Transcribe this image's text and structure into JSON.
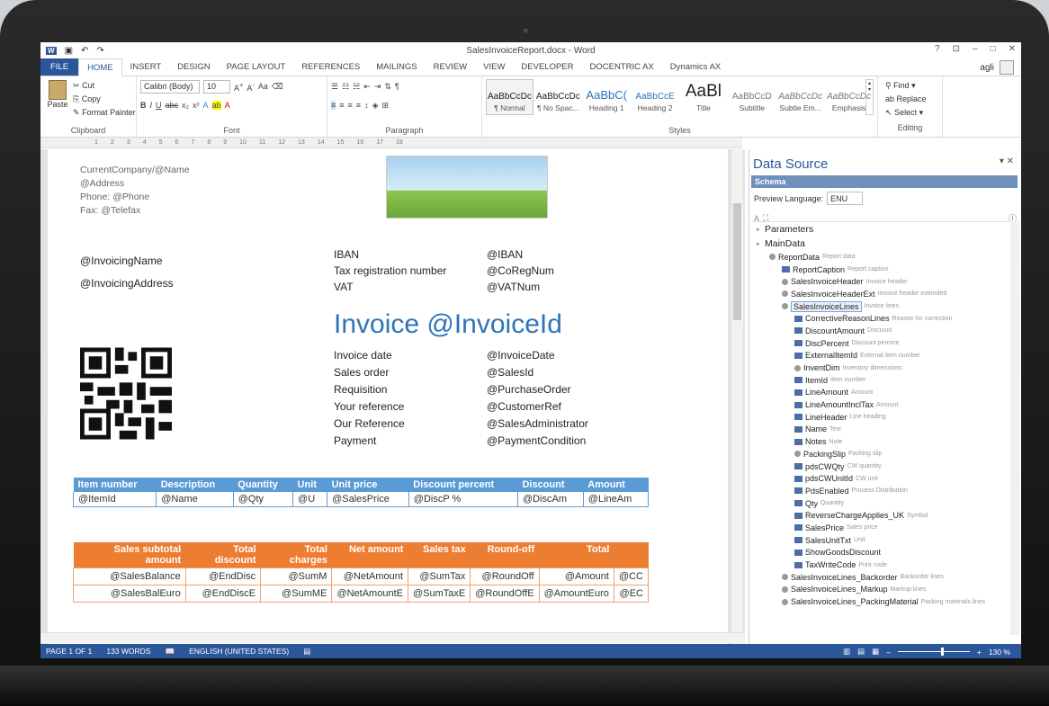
{
  "window": {
    "title": "SalesInvoiceReport.docx - Word",
    "help": "?",
    "user": "agli"
  },
  "tabs": [
    "FILE",
    "HOME",
    "INSERT",
    "DESIGN",
    "PAGE LAYOUT",
    "REFERENCES",
    "MAILINGS",
    "REVIEW",
    "VIEW",
    "DEVELOPER",
    "DOCENTRIC AX",
    "Dynamics AX"
  ],
  "ribbon": {
    "clipboard": {
      "paste": "Paste",
      "cut": "Cut",
      "copy": "Copy",
      "format_painter": "Format Painter",
      "label": "Clipboard"
    },
    "font": {
      "family": "Calibri (Body)",
      "size": "10",
      "label": "Font"
    },
    "paragraph": {
      "label": "Paragraph"
    },
    "styles": {
      "label": "Styles",
      "items": [
        {
          "preview": "AaBbCcDc",
          "name": "¶ Normal"
        },
        {
          "preview": "AaBbCcDc",
          "name": "¶ No Spac..."
        },
        {
          "preview": "AaBbC(",
          "name": "Heading 1"
        },
        {
          "preview": "AaBbCcE",
          "name": "Heading 2"
        },
        {
          "preview": "AaBl",
          "name": "Title"
        },
        {
          "preview": "AaBbCcD",
          "name": "Subtitle"
        },
        {
          "preview": "AaBbCcDc",
          "name": "Subtle Em..."
        },
        {
          "preview": "AaBbCcDc",
          "name": "Emphasis"
        }
      ]
    },
    "editing": {
      "find": "Find",
      "replace": "Replace",
      "select": "Select",
      "label": "Editing"
    }
  },
  "doc": {
    "company": "CurrentCompany/@Name",
    "address": "@Address",
    "phone": "Phone: @Phone",
    "fax": "Fax: @Telefax",
    "invoicing_name": "@InvoicingName",
    "invoicing_address": "@InvoicingAddress",
    "bank": [
      [
        "IBAN",
        "@IBAN"
      ],
      [
        "Tax registration number",
        "@CoRegNum"
      ],
      [
        "VAT",
        "@VATNum"
      ]
    ],
    "invoice_title": "Invoice @InvoiceId",
    "details": [
      [
        "Invoice date",
        "@InvoiceDate"
      ],
      [
        "Sales order",
        "@SalesId"
      ],
      [
        "Requisition",
        "@PurchaseOrder"
      ],
      [
        "Your reference",
        "@CustomerRef"
      ],
      [
        "Our Reference",
        "@SalesAdministrator"
      ],
      [
        "Payment",
        "@PaymentCondition"
      ]
    ],
    "lines_table": {
      "headers": [
        "Item number",
        "Description",
        "Quantity",
        "Unit",
        "Unit price",
        "Discount percent",
        "Discount",
        "Amount"
      ],
      "row": [
        "@ItemId",
        "@Name",
        "@Qty",
        "@U",
        "@SalesPrice",
        "@DiscP %",
        "@DiscAm",
        "@LineAm"
      ]
    },
    "totals_table": {
      "headers": [
        "Sales subtotal amount",
        "Total discount",
        "Total charges",
        "Net amount",
        "Sales tax",
        "Round-off",
        "Total",
        ""
      ],
      "rows": [
        [
          "@SalesBalance",
          "@EndDisc",
          "@SumM",
          "@NetAmount",
          "@SumTax",
          "@RoundOff",
          "@Amount",
          "@CC"
        ],
        [
          "@SalesBalEuro",
          "@EndDiscE",
          "@SumME",
          "@NetAmountE",
          "@SumTaxE",
          "@RoundOffE",
          "@AmountEuro",
          "@EC"
        ]
      ]
    }
  },
  "panel": {
    "title": "Data Source",
    "schema": "Schema",
    "preview_language_label": "Preview Language:",
    "preview_language": "ENU",
    "tree": [
      {
        "d": 0,
        "t": "arr",
        "n": "Parameters",
        "desc": ""
      },
      {
        "d": 0,
        "t": "arr",
        "n": "MainData",
        "desc": ""
      },
      {
        "d": 1,
        "t": "circ",
        "n": "ReportData",
        "desc": "Report data"
      },
      {
        "d": 2,
        "t": "bx",
        "n": "ReportCaption",
        "desc": "Report caption"
      },
      {
        "d": 2,
        "t": "circ",
        "n": "SalesInvoiceHeader",
        "desc": "Invoice header"
      },
      {
        "d": 2,
        "t": "circ",
        "n": "SalesInvoiceHeaderExt",
        "desc": "Invoice header extended"
      },
      {
        "d": 2,
        "t": "circ",
        "n": "SalesInvoiceLines",
        "desc": "Invoice lines",
        "sel": true
      },
      {
        "d": 3,
        "t": "bx",
        "n": "CorrectiveReasonLines",
        "desc": "Reason for correction"
      },
      {
        "d": 3,
        "t": "bx",
        "n": "DiscountAmount",
        "desc": "Discount"
      },
      {
        "d": 3,
        "t": "bx",
        "n": "DiscPercent",
        "desc": "Discount percent"
      },
      {
        "d": 3,
        "t": "bx",
        "n": "ExternalItemId",
        "desc": "External item number"
      },
      {
        "d": 3,
        "t": "circ",
        "n": "InventDim",
        "desc": "Inventory dimensions"
      },
      {
        "d": 3,
        "t": "bx",
        "n": "ItemId",
        "desc": "Item number"
      },
      {
        "d": 3,
        "t": "bx",
        "n": "LineAmount",
        "desc": "Amount"
      },
      {
        "d": 3,
        "t": "bx",
        "n": "LineAmountInclTax",
        "desc": "Amount"
      },
      {
        "d": 3,
        "t": "bx",
        "n": "LineHeader",
        "desc": "Line heading"
      },
      {
        "d": 3,
        "t": "bx",
        "n": "Name",
        "desc": "Text"
      },
      {
        "d": 3,
        "t": "bx",
        "n": "Notes",
        "desc": "Note"
      },
      {
        "d": 3,
        "t": "circ",
        "n": "PackingSlip",
        "desc": "Packing slip"
      },
      {
        "d": 3,
        "t": "bx",
        "n": "pdsCWQty",
        "desc": "CW quantity"
      },
      {
        "d": 3,
        "t": "bx",
        "n": "pdsCWUnitId",
        "desc": "CW unit"
      },
      {
        "d": 3,
        "t": "bx",
        "n": "PdsEnabled",
        "desc": "Process Distribution"
      },
      {
        "d": 3,
        "t": "bx",
        "n": "Qty",
        "desc": "Quantity"
      },
      {
        "d": 3,
        "t": "bx",
        "n": "ReverseChargeApplies_UK",
        "desc": "Symbol"
      },
      {
        "d": 3,
        "t": "bx",
        "n": "SalesPrice",
        "desc": "Sales price"
      },
      {
        "d": 3,
        "t": "bx",
        "n": "SalesUnitTxt",
        "desc": "Unit"
      },
      {
        "d": 3,
        "t": "bx",
        "n": "ShowGoodsDiscount",
        "desc": ""
      },
      {
        "d": 3,
        "t": "bx",
        "n": "TaxWriteCode",
        "desc": "Print code"
      },
      {
        "d": 2,
        "t": "circ",
        "n": "SalesInvoiceLines_Backorder",
        "desc": "Backorder lines"
      },
      {
        "d": 2,
        "t": "circ",
        "n": "SalesInvoiceLines_Markup",
        "desc": "Markup lines"
      },
      {
        "d": 2,
        "t": "circ",
        "n": "SalesInvoiceLines_PackingMaterial",
        "desc": "Packing materials lines"
      }
    ]
  },
  "status": {
    "page": "PAGE 1 OF 1",
    "words": "133 WORDS",
    "language": "ENGLISH (UNITED STATES)",
    "zoom": "130 %"
  }
}
